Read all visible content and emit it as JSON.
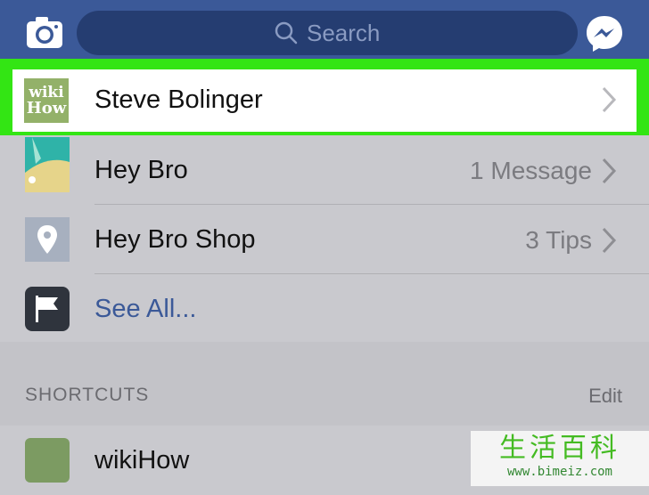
{
  "header": {
    "search_placeholder": "Search",
    "camera_icon": "camera-icon",
    "messenger_icon": "messenger-icon",
    "color": "#3b5998"
  },
  "highlighted_item": {
    "label": "Steve Bolinger",
    "thumb_text_top": "wiki",
    "thumb_text_bottom": "How"
  },
  "pages": [
    {
      "label": "Hey Bro",
      "right": "1 Message"
    },
    {
      "label": "Hey Bro Shop",
      "right": "3 Tips"
    },
    {
      "label": "See All..."
    }
  ],
  "shortcuts": {
    "title": "SHORTCUTS",
    "edit": "Edit",
    "items": [
      {
        "label": "wikiHow"
      }
    ]
  },
  "watermark": {
    "cn": "生活百科",
    "url": "www.bimeiz.com"
  },
  "colors": {
    "highlight": "#33e514",
    "link": "#3b5998",
    "background": "#c9c9ce"
  }
}
